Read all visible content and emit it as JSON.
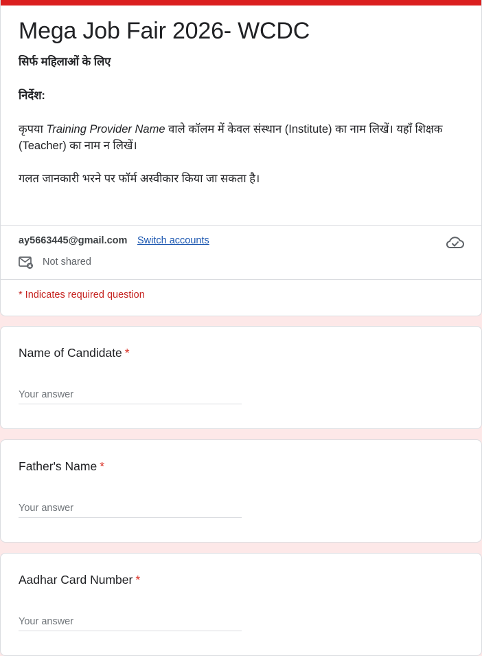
{
  "form": {
    "title": "Mega Job Fair 2026- WCDC",
    "subtitle": "सिर्फ महिलाओं के लिए",
    "instructions_heading": "निर्देश:",
    "instruction_1_pre": "कृपया ",
    "instruction_1_em": "Training Provider Name",
    "instruction_1_post": " वाले कॉलम में केवल संस्थान (Institute) का नाम लिखें। यहाँ शिक्षक (Teacher) का नाम न लिखें।",
    "instruction_2": "गलत जानकारी भरने पर फॉर्म अस्वीकार किया जा सकता है।"
  },
  "account": {
    "email": "ay5663445@gmail.com",
    "switch_label": "Switch accounts",
    "shared_status": "Not shared",
    "cloud_icon": "cloud-saved-icon",
    "share_icon": "mail-not-shared-icon"
  },
  "required_note": "* Indicates required question",
  "questions": [
    {
      "label": "Name of Candidate",
      "required_mark": "*",
      "placeholder": "Your answer"
    },
    {
      "label": "Father's Name",
      "required_mark": "*",
      "placeholder": "Your answer"
    },
    {
      "label": "Aadhar Card Number",
      "required_mark": "*",
      "placeholder": "Your answer"
    }
  ],
  "colors": {
    "accent_bar": "#db1f1f",
    "background": "#fde8e8",
    "required": "#d93025",
    "link": "#1a56b0"
  }
}
